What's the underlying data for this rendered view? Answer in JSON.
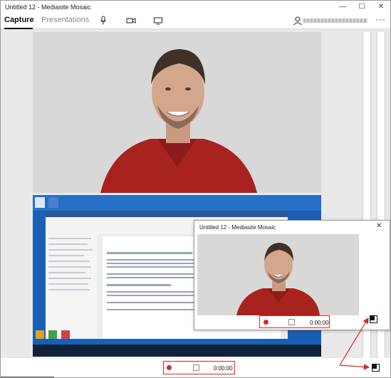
{
  "window": {
    "title": "Untitled 12 - Mediasite Mosaic",
    "controls": [
      "minimize",
      "maximize",
      "close"
    ]
  },
  "toolbar": {
    "tabs": [
      {
        "label": "Capture",
        "active": true
      },
      {
        "label": "Presentations",
        "active": false
      }
    ],
    "icons": [
      "microphone-icon",
      "camera-icon",
      "monitor-icon"
    ],
    "user_label": "",
    "more_label": "···"
  },
  "main_recorder": {
    "time": "0:00:00"
  },
  "mini_window": {
    "title": "Untitled 12 - Mediasite Mosaic",
    "close_label": "✕",
    "time": "0:00:00"
  },
  "colors": {
    "record_red": "#d9262c",
    "desktop_blue": "#1a5fb4",
    "shirt_red": "#a8231f"
  }
}
